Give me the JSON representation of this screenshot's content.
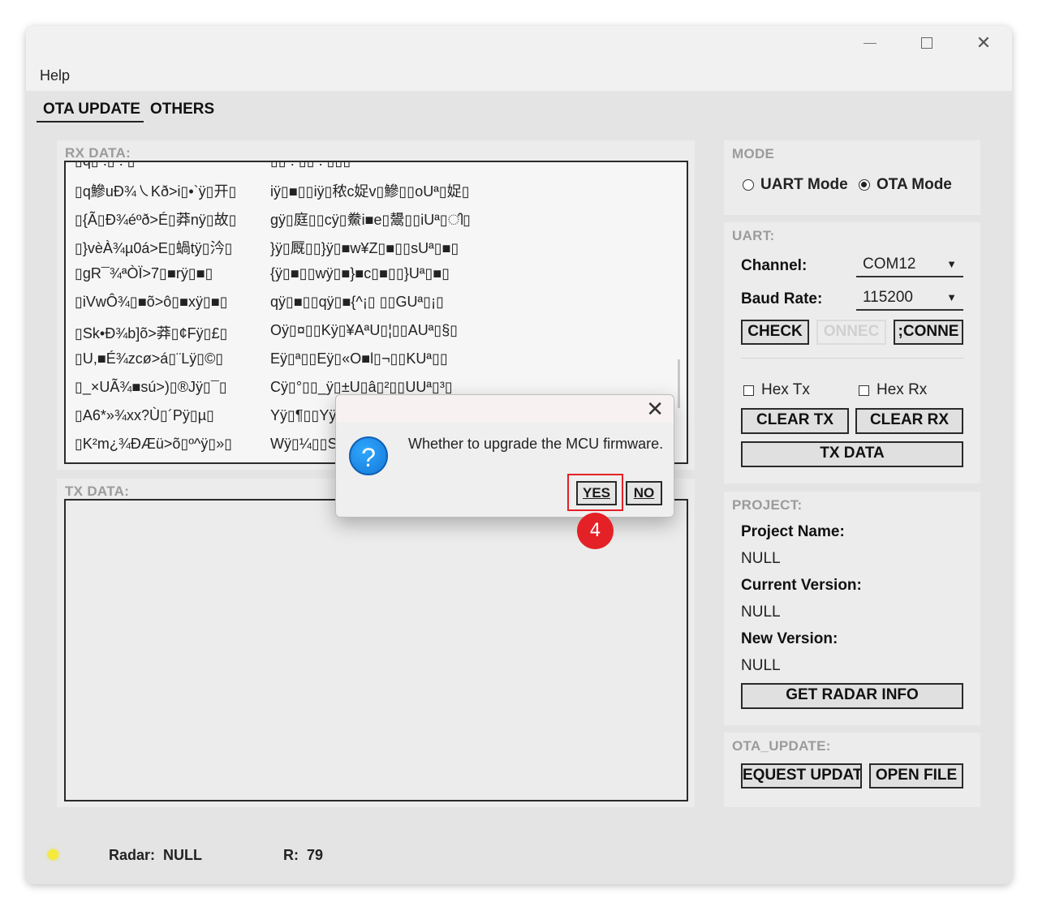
{
  "menu": {
    "help": "Help"
  },
  "tabs": {
    "ota": "OTA UPDATE",
    "others": "OTHERS"
  },
  "rx": {
    "label": "RX DATA:",
    "rows": [
      [
        "▯q鰺uĐ¾㇏Kð>i▯•`ÿ▯开▯",
        "iÿ▯■▯▯iÿ▯秾c娖v▯鰺▯▯oUª▯娖▯"
      ],
      [
        "▯{Ã▯Đ¾éºð>É▯莽nÿ▯故▯",
        "gÿ▯庭▯▯cÿ▯鮝i■e▯鬹▯▯iUª▯ി▯"
      ],
      [
        "▯}vèÀ¾µ0á>E▯蝸tÿ▯汵▯",
        "}ÿ▯厩▯▯}ÿ▯■w¥Z▯■▯▯sUª▯■▯"
      ],
      [
        "▯gR¯¾ªÒÏ>7▯■rÿ▯■▯",
        "{ÿ▯■▯▯wÿ▯■}■c▯■▯▯}Uª▯■▯"
      ],
      [
        "▯iVwÔ¾▯■õ>ô▯■xÿ▯■▯",
        "qÿ▯■▯▯qÿ▯■{^¡▯ ▯▯GUª▯¡▯"
      ],
      [
        "▯Sk•Đ¾b]õ>莽▯¢Fÿ▯£▯",
        "Oÿ▯¤▯▯Kÿ▯¥AªU▯¦▯▯AUª▯§▯"
      ],
      [
        "▯U,■É¾zcø>á▯¨Lÿ▯©▯",
        "Eÿ▯ª▯▯Eÿ▯«O■l▯¬▯▯KUª▯▯"
      ],
      [
        "▯_×UÃ¾■sú>)▯®Jÿ▯¯▯",
        "Cÿ▯°▯▯_ÿ▯±U▯â▯²▯▯UUª▯³▯"
      ],
      [
        "▯A6*»¾xx?Ù▯´Pÿ▯µ▯",
        "Yÿ▯¶▯▯Yÿ"
      ],
      [
        "▯K²m¿¾ĐÆü>õ▯º^ÿ▯»▯",
        "Wÿ▯¼▯▯S"
      ]
    ]
  },
  "tx": {
    "label": "TX DATA:"
  },
  "mode": {
    "label": "MODE",
    "uart": "UART Mode",
    "ota": "OTA Mode",
    "selected": "ota"
  },
  "uart": {
    "label": "UART:",
    "channel_label": "Channel:",
    "channel_value": "COM12",
    "baud_label": "Baud Rate:",
    "baud_value": "115200",
    "check": "CHECK",
    "connect": "ONNEC",
    "disconnect": ";CONNE",
    "hex_tx": "Hex Tx",
    "hex_rx": "Hex Rx",
    "clear_tx": "CLEAR TX",
    "clear_rx": "CLEAR RX",
    "tx_data": "TX DATA"
  },
  "project": {
    "label": "PROJECT:",
    "name_label": "Project Name:",
    "name_value": "NULL",
    "current_label": "Current Version:",
    "current_value": "NULL",
    "new_label": "New Version:",
    "new_value": "NULL",
    "get_info": "GET RADAR INFO"
  },
  "ota_update": {
    "label": "OTA_UPDATE:",
    "request": "EQUEST UPDAT",
    "open_file": "OPEN FILE"
  },
  "status": {
    "radar_label": "Radar:",
    "radar_value": "NULL",
    "r_label": "R:",
    "r_value": "79",
    "led_color": "#f5ea3b"
  },
  "dialog": {
    "message": "Whether to upgrade the MCU firmware.",
    "yes": "YES",
    "no": "NO",
    "icon": "question-icon"
  },
  "annotation": {
    "step": "4",
    "color": "#e42126"
  }
}
